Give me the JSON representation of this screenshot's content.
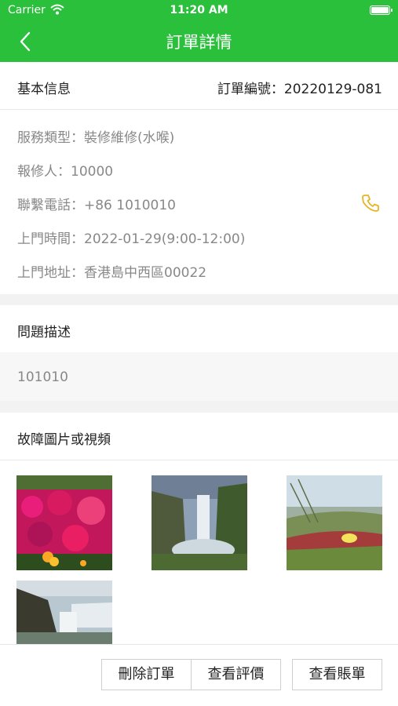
{
  "status_bar": {
    "carrier": "Carrier",
    "time": "11:20 AM"
  },
  "nav": {
    "title": "訂單詳情"
  },
  "basic_info": {
    "heading": "基本信息",
    "order_no_label": "訂單編號：",
    "order_no": "20220129-081",
    "fields": [
      {
        "label": "服務類型：",
        "value": "裝修維修(水喉)"
      },
      {
        "label": "報修人：",
        "value": "10000"
      },
      {
        "label": "聯繫電話：",
        "value": "+86 1010010"
      },
      {
        "label": "上門時間：",
        "value": "2022-01-29(9:00-12:00)"
      },
      {
        "label": "上門地址：",
        "value": "香港島中西區00022"
      }
    ]
  },
  "problem": {
    "heading": "問題描述",
    "text": "101010"
  },
  "media": {
    "heading": "故障圖片或視頻",
    "images": [
      "flowers-photo",
      "waterfall-photo",
      "grass-flower-photo",
      "waterfall-coast-photo"
    ]
  },
  "actions": {
    "delete_order": "刪除訂單",
    "view_review": "查看評價",
    "view_bill": "查看賬單"
  },
  "colors": {
    "brand_green": "#2ac03c",
    "phone_icon": "#e6b422"
  }
}
